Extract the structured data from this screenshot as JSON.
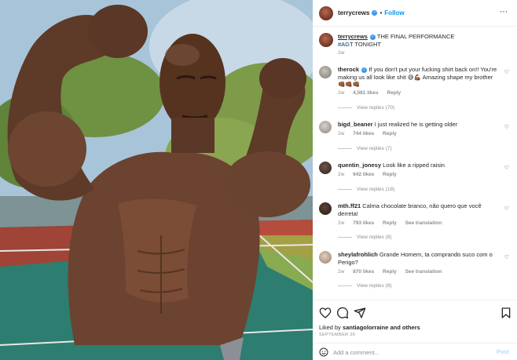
{
  "photo": {
    "description_icon": "photo"
  },
  "header": {
    "username": "terrycrews",
    "separator": "•",
    "follow_label": "Follow",
    "more_label": "⋯"
  },
  "caption": {
    "username": "terrycrews",
    "text": "THE FINAL PERFORMANCE",
    "hashtag": "#AGT",
    "text_after": " TONIGHT",
    "time": "2w"
  },
  "comments": [
    {
      "username": "therock",
      "verified": true,
      "text": "If you don't put your fucking shirt back on!! You're making us all look like shit 😅💪🏾 Amazing shape my brother 👊🏾👊🏾👊🏾",
      "time": "2w",
      "likes": "4,581 likes",
      "reply_label": "Reply",
      "extra_label": "",
      "replies": "View replies (70)"
    },
    {
      "username": "bigd_beaner",
      "verified": false,
      "text": "I just realized he is getting older",
      "time": "2w",
      "likes": "744 likes",
      "reply_label": "Reply",
      "extra_label": "",
      "replies": "View replies (7)"
    },
    {
      "username": "quentin_jonesy",
      "verified": false,
      "text": "Look like a ripped raisin",
      "time": "2w",
      "likes": "642 likes",
      "reply_label": "Reply",
      "extra_label": "",
      "replies": "View replies (18)"
    },
    {
      "username": "mth.ff21",
      "verified": false,
      "text": "Calma chocolate branco, não quero que você derreta!",
      "time": "2w",
      "likes": "793 likes",
      "reply_label": "Reply",
      "extra_label": "See translation",
      "replies": "View replies (8)"
    },
    {
      "username": "sheylafrohlich",
      "verified": false,
      "text": "Grande Homem, ta comprando suco com o Perigo?",
      "time": "2w",
      "likes": "870 likes",
      "reply_label": "Reply",
      "extra_label": "See translation",
      "replies": "View replies (8)"
    }
  ],
  "footer": {
    "liked_by_prefix": "Liked by ",
    "liked_by_user": "santiagolorraine",
    "liked_by_suffix": " and others",
    "date": "SEPTEMBER 26",
    "comment_placeholder": "Add a comment...",
    "post_label": "Post"
  },
  "icons": {
    "heart": "heart-icon",
    "comment": "comment-icon",
    "share": "share-icon",
    "save": "bookmark-icon",
    "emoji": "emoji-icon",
    "verified": "verified-badge-icon",
    "more": "more-options-icon"
  },
  "colors": {
    "accent": "#0095f6",
    "verified": "#3897f0",
    "muted": "#8e8e8e"
  }
}
